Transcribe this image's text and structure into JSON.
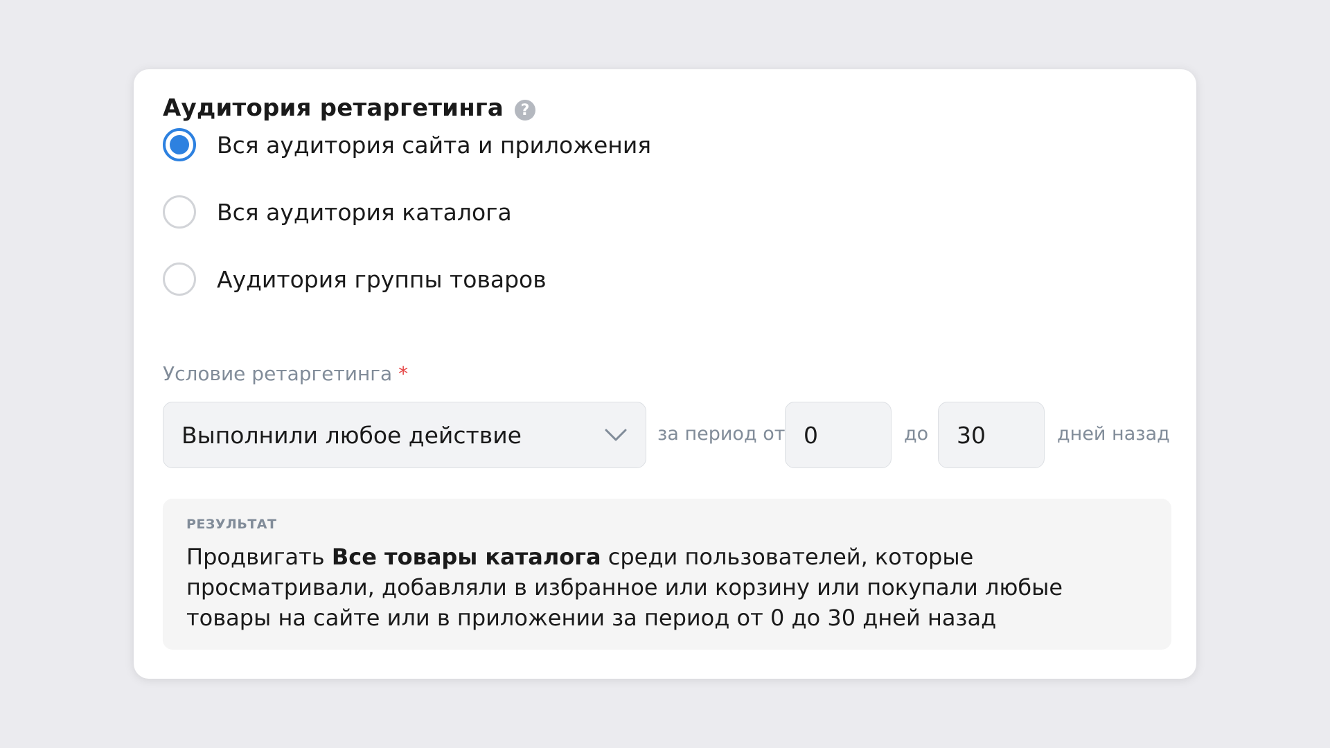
{
  "section": {
    "title": "Аудитория ретаргетинга",
    "help_icon": "question-mark-icon",
    "help_glyph": "?"
  },
  "audience_options": [
    {
      "label": "Вся аудитория сайта и приложения",
      "checked": true
    },
    {
      "label": "Вся аудитория каталога",
      "checked": false
    },
    {
      "label": "Аудитория группы товаров",
      "checked": false
    }
  ],
  "condition": {
    "label": "Условие ретаргетинга",
    "required_mark": "*",
    "selected": "Выполнили любое действие",
    "period_from_label": "за период от",
    "from_value": "0",
    "to_label": "до",
    "to_value": "30",
    "suffix": "дней назад"
  },
  "result": {
    "caption": "РЕЗУЛЬТАТ",
    "text_prefix": "Продвигать ",
    "text_bold": "Все товары каталога",
    "text_suffix": " среди пользователей, которые просматривали, добавляли в избранное или корзину или покупали любые товары на сайте или в приложении за период от 0 до 30 дней назад"
  },
  "colors": {
    "accent": "#2d81e0",
    "background": "#ebebef",
    "required": "#e64646"
  }
}
